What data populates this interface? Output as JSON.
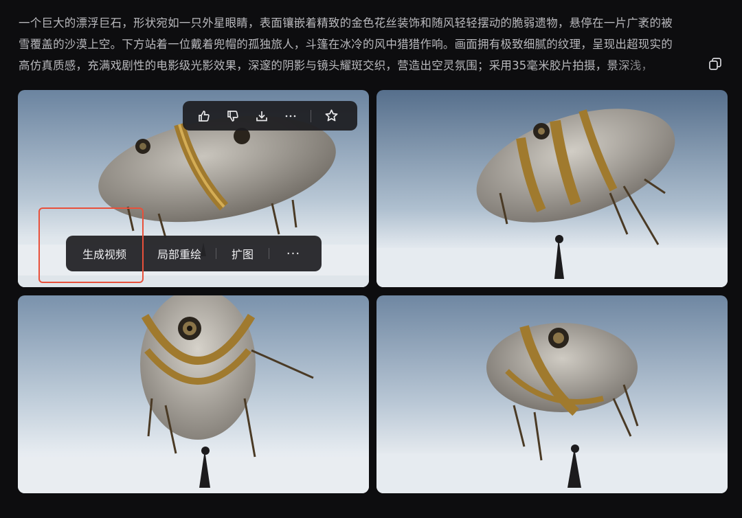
{
  "prompt": {
    "line1": "一个巨大的漂浮巨石，形状宛如一只外星眼睛，表面镶嵌着精致的金色花丝装饰和随风轻轻摆动的脆弱遗物，悬停在一片广袤的被",
    "line2": "雪覆盖的沙漠上空。下方站着一位戴着兜帽的孤独旅人，斗篷在冰冷的风中猎猎作响。画面拥有极致细腻的纹理，呈现出超现实的",
    "line3": "高仿真质感，充满戏剧性的电影级光影效果，深邃的阴影与镜头耀斑交织，营造出空灵氛围；采用35毫米胶片拍摄，景深浅，"
  },
  "copy_icon": "copy-icon",
  "toolbar": {
    "icons": [
      "thumbs-up-icon",
      "thumbs-down-icon",
      "download-icon",
      "more-icon",
      "star-icon"
    ],
    "more_label": "···"
  },
  "action_bar": {
    "generate_video": "生成视频",
    "local_redraw": "局部重绘",
    "expand_image": "扩图",
    "more": "···"
  },
  "colors": {
    "background": "#0d0d0f",
    "text": "#b9b9bd",
    "highlight": "#e8503a",
    "panel": "#242427"
  }
}
